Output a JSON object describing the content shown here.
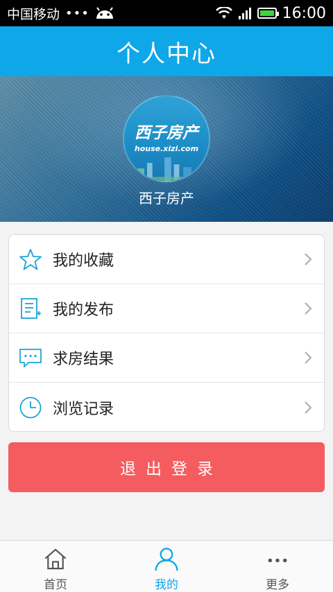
{
  "status_bar": {
    "carrier": "中国移动",
    "dots": "•••",
    "time": "16:00"
  },
  "header": {
    "title": "个人中心"
  },
  "profile": {
    "avatar_logo_text": "西子房产",
    "avatar_url_text": "house.xizi.com",
    "username": "西子房产"
  },
  "menu": {
    "items": [
      {
        "label": "我的收藏",
        "icon": "star-icon"
      },
      {
        "label": "我的发布",
        "icon": "document-edit-icon"
      },
      {
        "label": "求房结果",
        "icon": "chat-bubble-icon"
      },
      {
        "label": "浏览记录",
        "icon": "clock-icon"
      }
    ]
  },
  "logout": {
    "label": "退出登录"
  },
  "bottom_nav": {
    "items": [
      {
        "label": "首页",
        "icon": "home-icon",
        "active": false
      },
      {
        "label": "我的",
        "icon": "user-icon",
        "active": true
      },
      {
        "label": "更多",
        "icon": "more-icon",
        "active": false
      }
    ]
  },
  "colors": {
    "accent": "#0ea7e8",
    "logout": "#f45c5f",
    "icon": "#1aa3d8"
  }
}
